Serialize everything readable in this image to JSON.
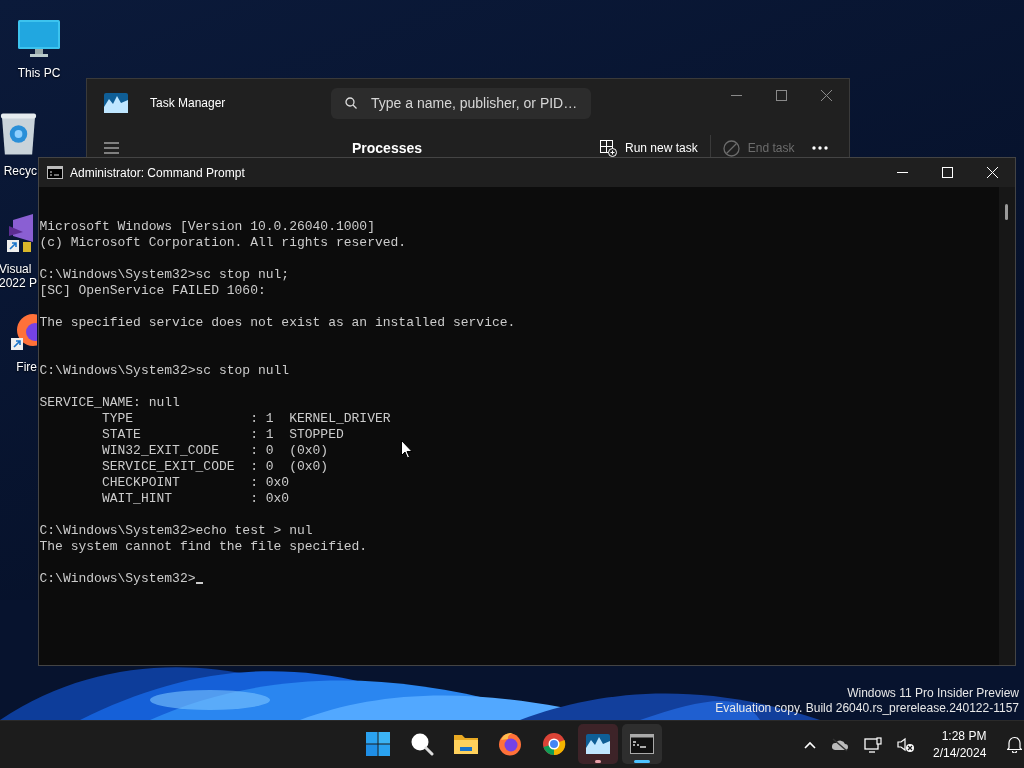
{
  "desktop_icons": [
    {
      "kind": "monitor",
      "label_lines": [
        "This PC"
      ]
    },
    {
      "kind": "recycle-bin",
      "label_lines": [
        "Recyc"
      ]
    },
    {
      "kind": "studio",
      "label_lines": [
        "Visual",
        "2022 P"
      ]
    },
    {
      "kind": "fox-browser",
      "label_lines": [
        "Fire"
      ]
    }
  ],
  "edition_notice": [
    "Windows 11 Pro Insider Preview",
    "Evaluation copy. Build 26040.rs_prerelease.240122-1157"
  ],
  "task_manager": {
    "title": "Task Manager",
    "search": {
      "placeholder": "Type a name, publisher, or PID…"
    },
    "page_title": "Processes",
    "actions": [
      {
        "kind": "run",
        "label": "Run new task",
        "disabled": false
      },
      {
        "kind": "end",
        "label": "End task",
        "disabled": true
      }
    ]
  },
  "command_prompt": {
    "title": "Administrator: Command Prompt",
    "cursor": true,
    "lines": [
      {
        "kind": "text",
        "text": "Microsoft Windows [Version 10.0.26040.1000]"
      },
      {
        "kind": "text",
        "text": "(c) Microsoft Corporation. All rights reserved."
      },
      {
        "kind": "blank"
      },
      {
        "kind": "text",
        "text": "C:\\Windows\\System32>sc stop nul;"
      },
      {
        "kind": "text",
        "text": "[SC] OpenService FAILED 1060:"
      },
      {
        "kind": "blank"
      },
      {
        "kind": "text",
        "text": "The specified service does not exist as an installed service."
      },
      {
        "kind": "blank"
      },
      {
        "kind": "blank"
      },
      {
        "kind": "text",
        "text": "C:\\Windows\\System32>sc stop null"
      },
      {
        "kind": "blank"
      },
      {
        "kind": "text",
        "text": "SERVICE_NAME: null"
      },
      {
        "kind": "text",
        "text": "        TYPE               : 1  KERNEL_DRIVER"
      },
      {
        "kind": "text",
        "text": "        STATE              : 1  STOPPED"
      },
      {
        "kind": "text",
        "text": "        WIN32_EXIT_CODE    : 0  (0x0)"
      },
      {
        "kind": "text",
        "text": "        SERVICE_EXIT_CODE  : 0  (0x0)"
      },
      {
        "kind": "text",
        "text": "        CHECKPOINT         : 0x0"
      },
      {
        "kind": "text",
        "text": "        WAIT_HINT          : 0x0"
      },
      {
        "kind": "blank"
      },
      {
        "kind": "text",
        "text": "C:\\Windows\\System32>echo test > nul"
      },
      {
        "kind": "text",
        "text": "The system cannot find the file specified."
      },
      {
        "kind": "blank"
      },
      {
        "kind": "text",
        "text": "C:\\Windows\\System32>"
      }
    ]
  },
  "taskbar": {
    "apps": [
      {
        "kind": "start",
        "active": false,
        "attention": false
      },
      {
        "kind": "search",
        "active": false,
        "attention": false
      },
      {
        "kind": "folder",
        "active": false,
        "attention": false
      },
      {
        "kind": "fox-browser",
        "active": false,
        "attention": false
      },
      {
        "kind": "ring-browser",
        "active": false,
        "attention": false
      },
      {
        "kind": "task-manager",
        "active": false,
        "attention": true
      },
      {
        "kind": "terminal",
        "active": true,
        "attention": false
      }
    ],
    "tray": [
      {
        "kind": "chevron"
      },
      {
        "kind": "cloud-off"
      },
      {
        "kind": "network"
      },
      {
        "kind": "speaker-muted"
      }
    ],
    "clock": {
      "time": "1:28 PM",
      "date": "2/14/2024"
    }
  }
}
